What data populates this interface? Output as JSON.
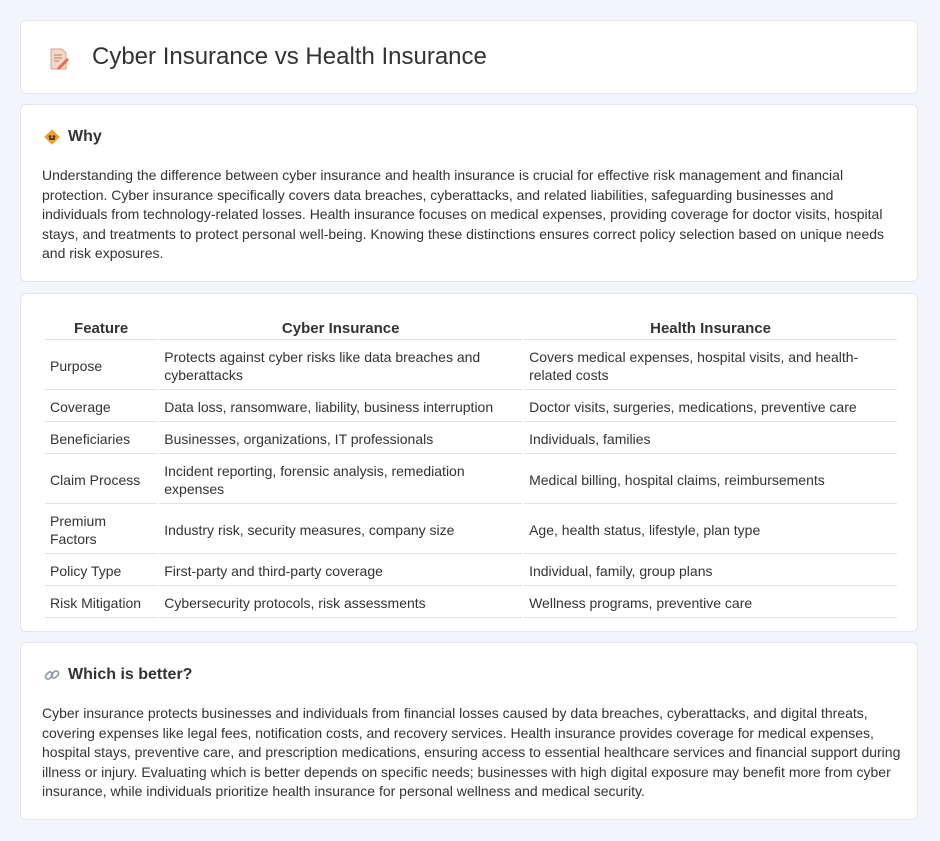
{
  "header": {
    "title": "Cyber Insurance vs Health Insurance",
    "icon": "document-pencil-icon"
  },
  "why": {
    "title": "Why",
    "icon": "diamond-sign-icon",
    "text": "Understanding the difference between cyber insurance and health insurance is crucial for effective risk management and financial protection. Cyber insurance specifically covers data breaches, cyberattacks, and related liabilities, safeguarding businesses and individuals from technology-related losses. Health insurance focuses on medical expenses, providing coverage for doctor visits, hospital stays, and treatments to protect personal well-being. Knowing these distinctions ensures correct policy selection based on unique needs and risk exposures."
  },
  "table": {
    "headers": [
      "Feature",
      "Cyber Insurance",
      "Health Insurance"
    ],
    "rows": [
      [
        "Purpose",
        "Protects against cyber risks like data breaches and cyberattacks",
        "Covers medical expenses, hospital visits, and health-related costs"
      ],
      [
        "Coverage",
        "Data loss, ransomware, liability, business interruption",
        "Doctor visits, surgeries, medications, preventive care"
      ],
      [
        "Beneficiaries",
        "Businesses, organizations, IT professionals",
        "Individuals, families"
      ],
      [
        "Claim Process",
        "Incident reporting, forensic analysis, remediation expenses",
        "Medical billing, hospital claims, reimbursements"
      ],
      [
        "Premium Factors",
        "Industry risk, security measures, company size",
        "Age, health status, lifestyle, plan type"
      ],
      [
        "Policy Type",
        "First-party and third-party coverage",
        "Individual, family, group plans"
      ],
      [
        "Risk Mitigation",
        "Cybersecurity protocols, risk assessments",
        "Wellness programs, preventive care"
      ]
    ]
  },
  "better": {
    "title": "Which is better?",
    "icon": "link-icon",
    "text": "Cyber insurance protects businesses and individuals from financial losses caused by data breaches, cyberattacks, and digital threats, covering expenses like legal fees, notification costs, and recovery services. Health insurance provides coverage for medical expenses, hospital stays, preventive care, and prescription medications, ensuring access to essential healthcare services and financial support during illness or injury. Evaluating which is better depends on specific needs; businesses with high digital exposure may benefit more from cyber insurance, while individuals prioritize health insurance for personal wellness and medical security."
  },
  "colors": {
    "background": "#f3f5fa",
    "card": "#ffffff",
    "border": "#e3e6ee",
    "text": "#333333",
    "icon_orange": "#f0a030"
  }
}
